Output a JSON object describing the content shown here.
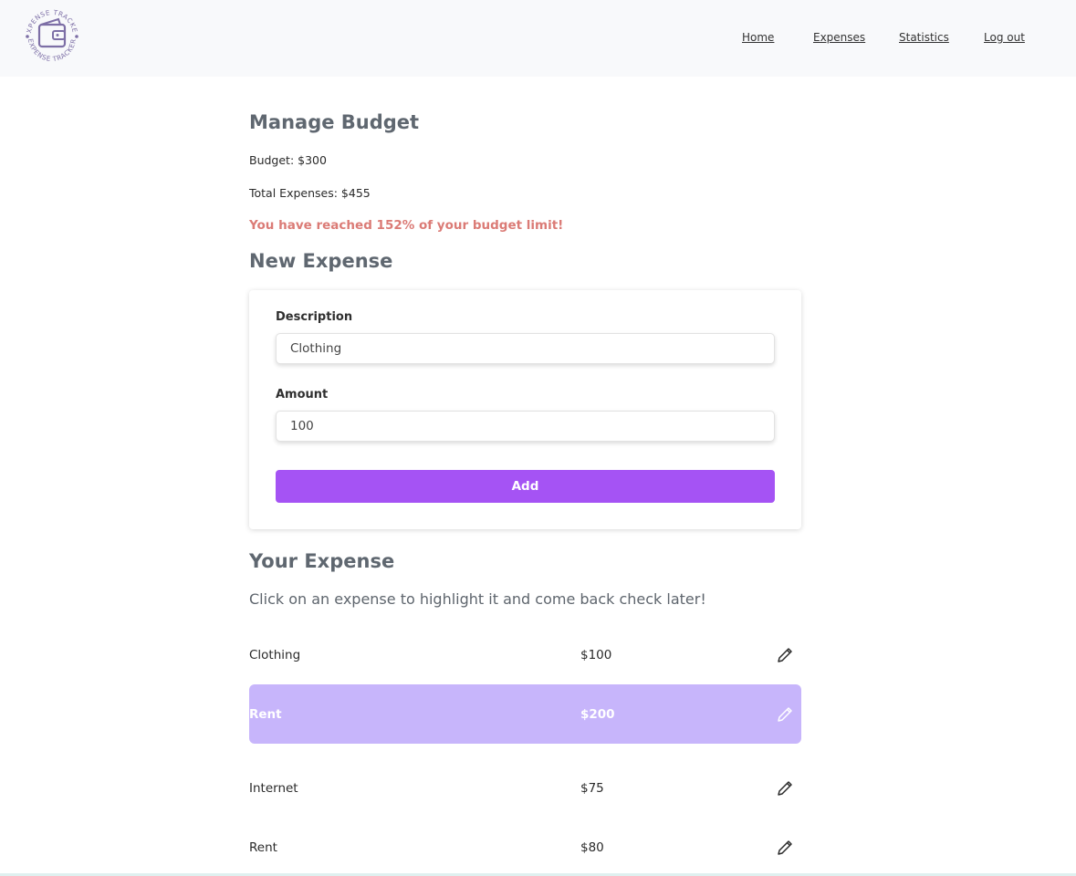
{
  "brand": {
    "logo_text": "EXPENSE TRACKER"
  },
  "nav": {
    "home": "Home",
    "expenses": "Expenses",
    "statistics": "Statistics",
    "logout": "Log out"
  },
  "budget": {
    "title": "Manage Budget",
    "budget_line": "Budget: $300",
    "total_line": "Total Expenses: $455",
    "warning": "You have reached 152% of your budget limit!"
  },
  "new_expense": {
    "title": "New Expense",
    "description_label": "Description",
    "description_value": "Clothing",
    "amount_label": "Amount",
    "amount_value": "100",
    "add_label": "Add"
  },
  "expenses": {
    "title": "Your Expense",
    "hint": "Click on an expense to highlight it and come back check later!",
    "items": [
      {
        "description": "Clothing",
        "amount": "$100",
        "highlighted": false
      },
      {
        "description": "Rent",
        "amount": "$200",
        "highlighted": true
      },
      {
        "description": "Internet",
        "amount": "$75",
        "highlighted": false
      },
      {
        "description": "Rent",
        "amount": "$80",
        "highlighted": false
      }
    ]
  },
  "colors": {
    "accent": "#a553f4",
    "highlight": "#c7b5fb",
    "warning": "#db7b76",
    "navbar_bg": "#f8f9fb",
    "heading": "#5f6770",
    "logo": "#7d6fa6"
  },
  "icons": {
    "edit": "pencil-icon",
    "logo": "wallet-icon"
  }
}
